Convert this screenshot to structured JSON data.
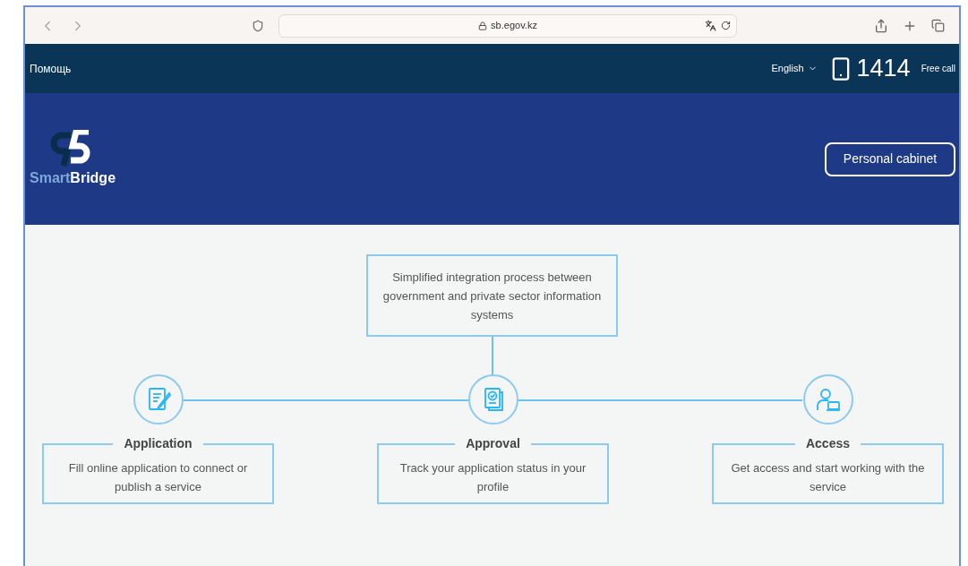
{
  "browser": {
    "url": "sb.egov.kz"
  },
  "topbar": {
    "help": "Помощь",
    "language": "English",
    "phone": "1414",
    "phone_note": "Free call"
  },
  "header": {
    "logo_text_1": "Smart",
    "logo_text_2": "Bridge",
    "cabinet_button": "Personal cabinet"
  },
  "process": {
    "summary": "Simplified integration process between government and private sector information systems",
    "steps": [
      {
        "kind": "application",
        "title": "Application",
        "text": "Fill online application to connect or publish a service"
      },
      {
        "kind": "approval",
        "title": "Approval",
        "text": "Track your application status in your profile"
      },
      {
        "kind": "access",
        "title": "Access",
        "text": "Get access and start working with the service"
      }
    ]
  }
}
